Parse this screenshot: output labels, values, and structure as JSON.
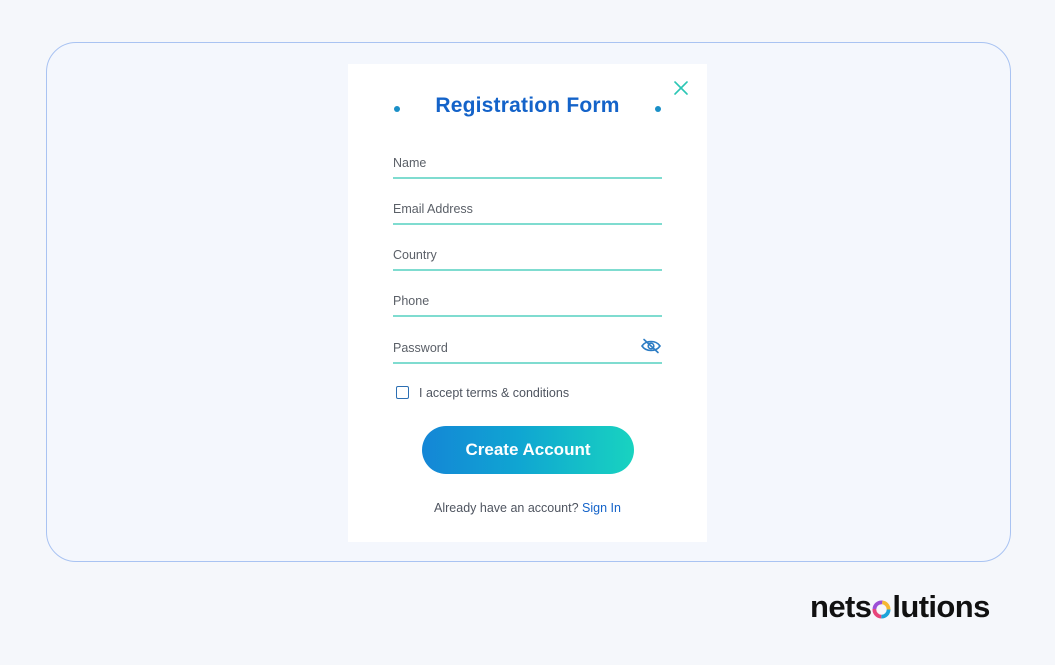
{
  "form": {
    "title": "Registration Form",
    "fields": [
      {
        "placeholder": "Name"
      },
      {
        "placeholder": "Email Address"
      },
      {
        "placeholder": "Country"
      },
      {
        "placeholder": "Phone"
      },
      {
        "placeholder": "Password"
      }
    ],
    "terms_label": "I accept terms & conditions",
    "terms_checked": false,
    "submit_label": "Create Account",
    "signin_prompt": "Already have an account?",
    "signin_link": "Sign In"
  },
  "brand": {
    "prefix": "nets",
    "suffix": "lutions"
  },
  "icons": {
    "close": "close-icon",
    "password_toggle": "eye-slash-icon",
    "brand_mark": "ring-logo-icon"
  },
  "colors": {
    "accent": "#1463c9",
    "field_underline": "#7fdcd0",
    "cta_gradient_start": "#1486d6",
    "cta_gradient_end": "#18d3c0",
    "frame_border": "#a9c3f2"
  }
}
